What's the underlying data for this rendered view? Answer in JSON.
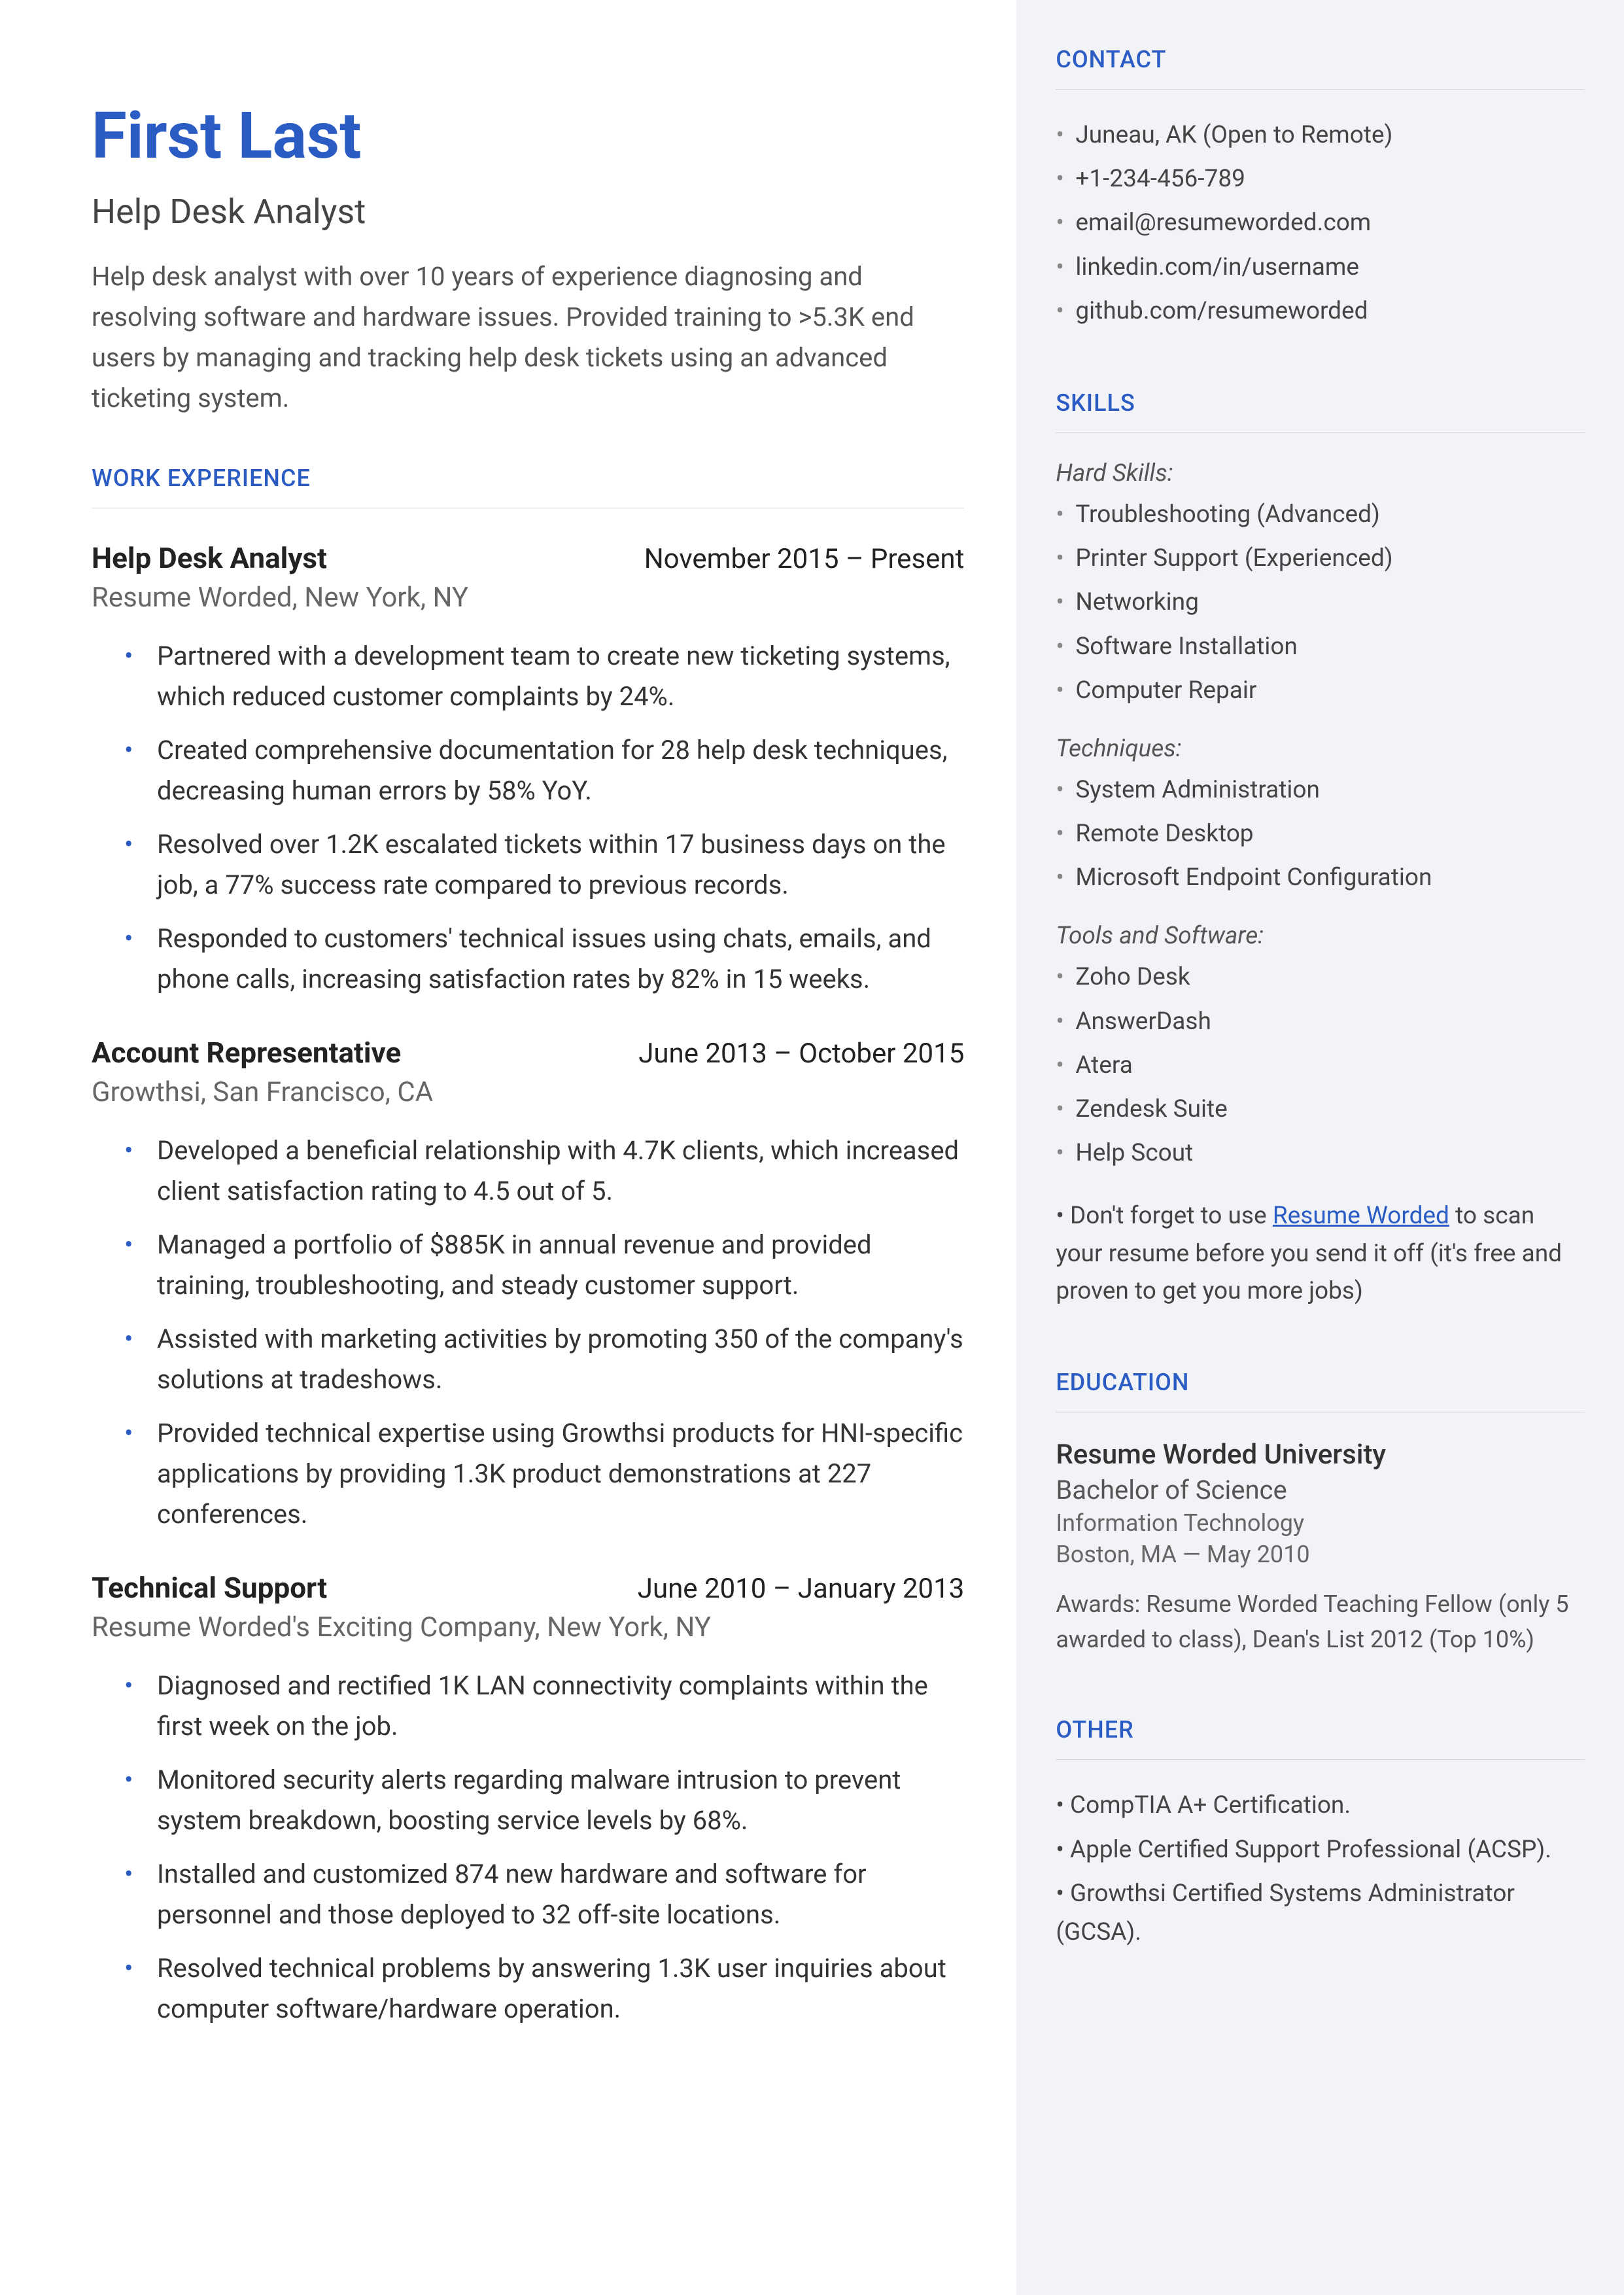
{
  "header": {
    "name": "First Last",
    "title": "Help Desk Analyst",
    "summary": "Help desk analyst with over 10 years of experience diagnosing and resolving software and hardware issues. Provided training to >5.3K end users by managing and tracking help desk tickets using an advanced ticketing system."
  },
  "work_heading": "WORK EXPERIENCE",
  "jobs": [
    {
      "title": "Help Desk Analyst",
      "dates": "November 2015 – Present",
      "company": "Resume Worded, New York, NY",
      "bullets": [
        "Partnered with a development team to create new ticketing systems, which reduced customer complaints by 24%.",
        "Created comprehensive documentation for 28 help desk techniques, decreasing human errors by 58% YoY.",
        "Resolved over 1.2K escalated tickets within 17 business days on the job, a 77% success rate compared to previous records.",
        "Responded to customers' technical issues using chats, emails, and phone calls, increasing satisfaction rates by 82% in 15 weeks."
      ]
    },
    {
      "title": "Account Representative",
      "dates": "June 2013 – October 2015",
      "company": "Growthsi, San Francisco, CA",
      "bullets": [
        "Developed a beneficial relationship with 4.7K clients, which increased client satisfaction rating to 4.5 out of 5.",
        "Managed a portfolio of $885K in annual revenue and provided training, troubleshooting, and steady customer support.",
        "Assisted with marketing activities by promoting 350 of the company's solutions at tradeshows.",
        "Provided technical expertise using Growthsi products for HNI-specific applications by providing 1.3K product demonstrations at 227 conferences."
      ]
    },
    {
      "title": "Technical Support",
      "dates": "June 2010 – January 2013",
      "company": "Resume Worded's Exciting Company, New York, NY",
      "bullets": [
        "Diagnosed and rectified 1K LAN connectivity complaints within the first week on the job.",
        "Monitored security alerts regarding malware intrusion to prevent system breakdown, boosting service levels by 68%.",
        "Installed and customized 874 new hardware and software for personnel and those deployed to 32 off-site locations.",
        "Resolved technical problems by answering 1.3K user inquiries about computer software/hardware operation."
      ]
    }
  ],
  "contact": {
    "heading": "CONTACT",
    "items": [
      "Juneau, AK (Open to Remote)",
      "+1-234-456-789",
      "email@resumeworded.com",
      "linkedin.com/in/username",
      "github.com/resumeworded"
    ]
  },
  "skills": {
    "heading": "SKILLS",
    "groups": [
      {
        "label": "Hard Skills:",
        "items": [
          "Troubleshooting (Advanced)",
          "Printer Support (Experienced)",
          "Networking",
          "Software Installation",
          "Computer Repair"
        ]
      },
      {
        "label": "Techniques:",
        "items": [
          "System Administration",
          "Remote Desktop",
          "Microsoft Endpoint Configuration"
        ]
      },
      {
        "label": "Tools and Software:",
        "items": [
          "Zoho Desk",
          "AnswerDash",
          "Atera",
          "Zendesk Suite",
          "Help Scout"
        ]
      }
    ],
    "note_prefix": "•  Don't forget to use ",
    "note_link": "Resume Worded",
    "note_suffix": " to scan your resume before you send it off (it's free and proven to get you more jobs)"
  },
  "education": {
    "heading": "EDUCATION",
    "school": "Resume Worded University",
    "degree": "Bachelor of Science",
    "field": "Information Technology",
    "location": "Boston, MA — May 2010",
    "awards": "Awards: Resume Worded Teaching Fellow (only 5 awarded to class), Dean's List 2012 (Top 10%)"
  },
  "other": {
    "heading": "OTHER",
    "items": [
      "•  CompTIA A+ Certification.",
      "•  Apple Certified Support Professional (ACSP).",
      "•  Growthsi Certified Systems Administrator (GCSA)."
    ]
  }
}
